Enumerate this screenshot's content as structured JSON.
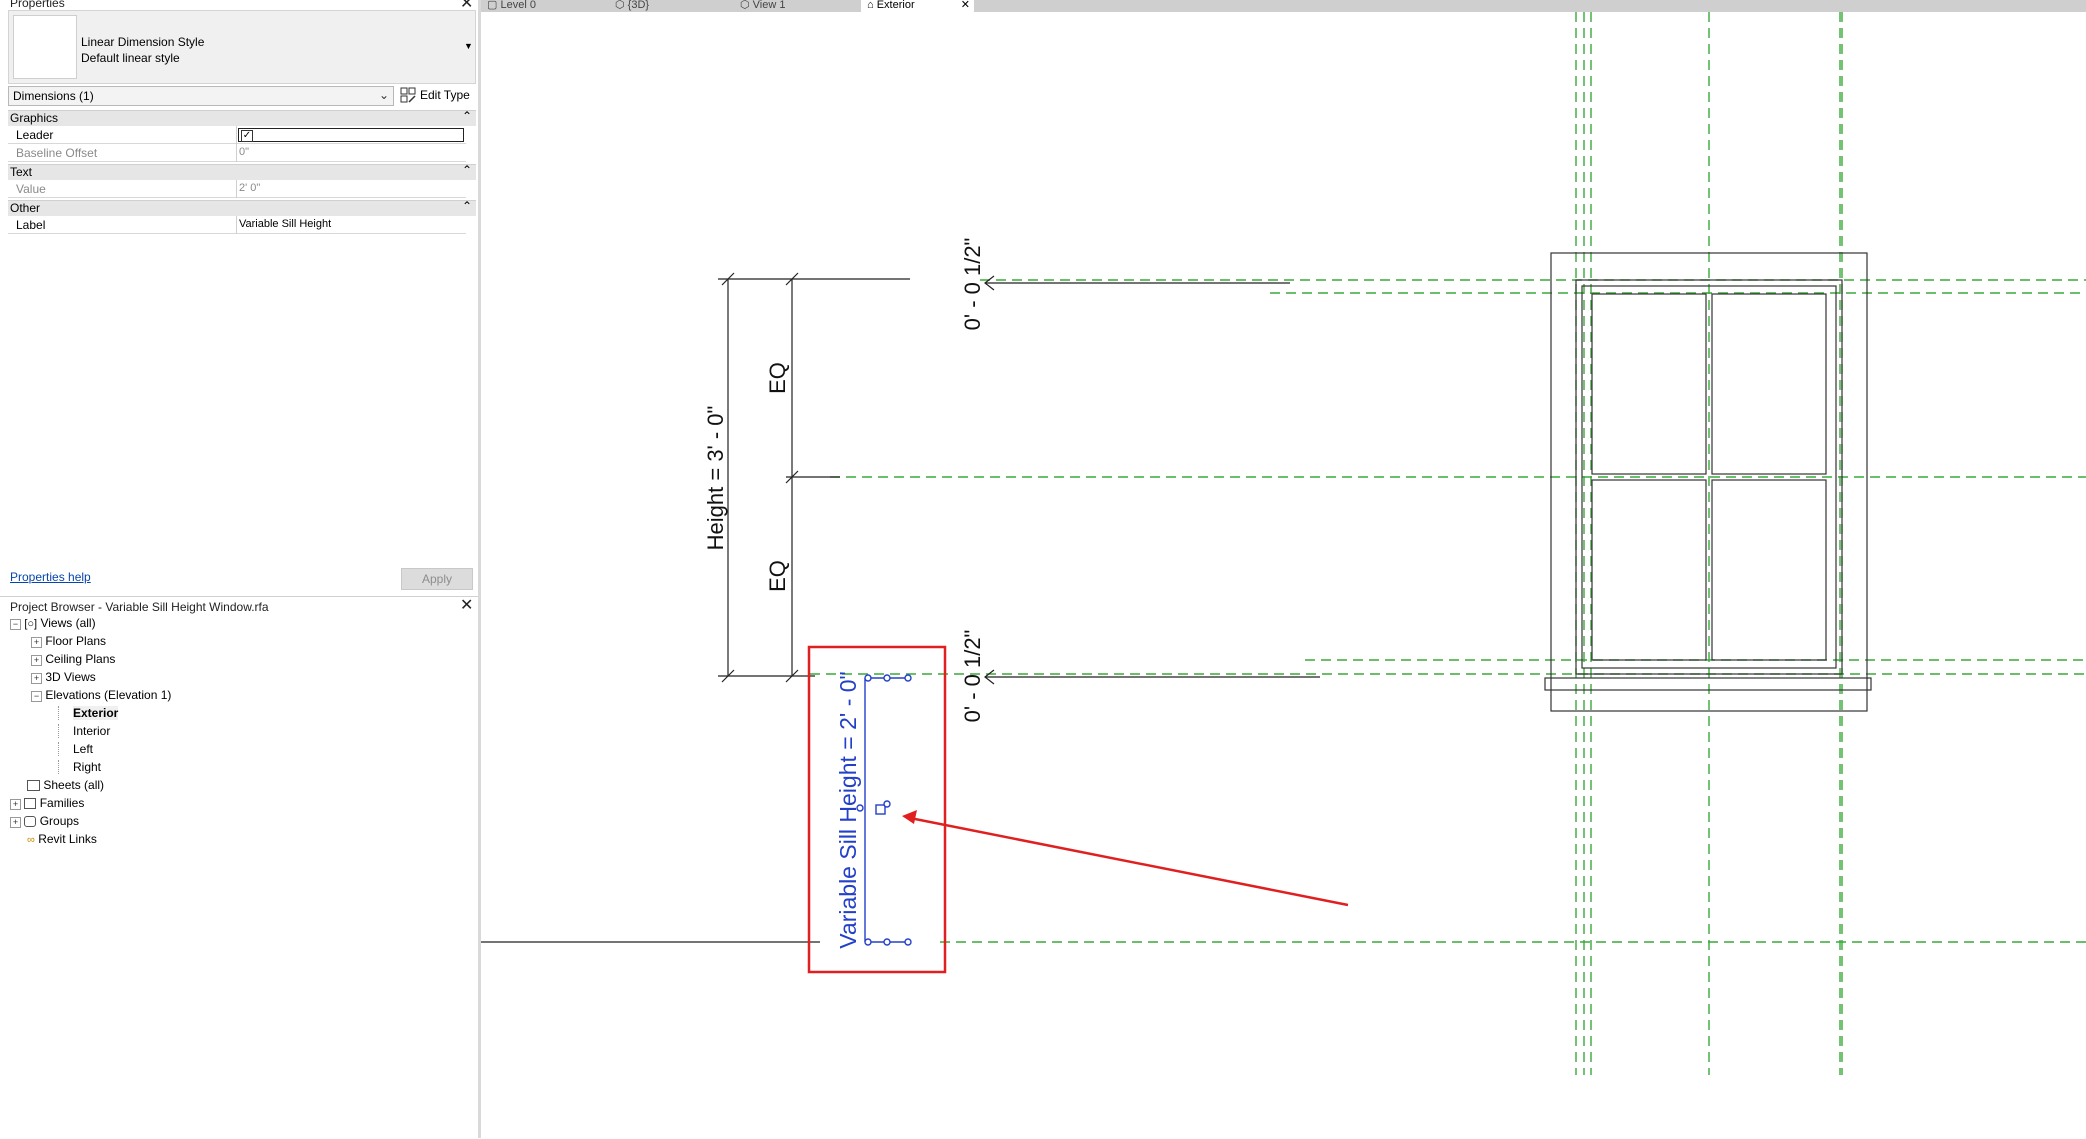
{
  "properties": {
    "title": "Properties",
    "type_line1": "Linear Dimension Style",
    "type_line2": "Default linear style",
    "selector": "Dimensions (1)",
    "edit_type": "Edit Type",
    "categories": {
      "graphics": "Graphics",
      "text": "Text",
      "other": "Other"
    },
    "rows": {
      "leader": {
        "key": "Leader",
        "checked": true
      },
      "baseline_offset": {
        "key": "Baseline Offset",
        "value": "0\""
      },
      "value": {
        "key": "Value",
        "value": "2'  0\""
      },
      "label": {
        "key": "Label",
        "value": "Variable Sill Height"
      }
    },
    "help": "Properties help",
    "apply": "Apply"
  },
  "browser": {
    "title": "Project Browser - Variable Sill Height Window.rfa",
    "items": {
      "views": "Views (all)",
      "floor_plans": "Floor Plans",
      "ceiling_plans": "Ceiling Plans",
      "views_3d": "3D Views",
      "elevations": "Elevations (Elevation 1)",
      "exterior": "Exterior",
      "interior": "Interior",
      "left": "Left",
      "right": "Right",
      "sheets": "Sheets (all)",
      "families": "Families",
      "groups": "Groups",
      "revit_links": "Revit Links"
    }
  },
  "tabs": [
    "Level 0",
    "{3D}",
    "View 1",
    "Exterior"
  ],
  "drawing": {
    "height_dim": "Height = 3' - 0\"",
    "eq_top": "EQ",
    "eq_bottom": "EQ",
    "offset_top": "0' - 0 1/2\"",
    "offset_bottom": "0' - 0 1/2\"",
    "sill_dim": "Variable Sill Height = 2' - 0\""
  },
  "colors": {
    "reference_green": "#3aa83a",
    "selected_blue": "#2340c8",
    "highlight_red": "#e02020"
  }
}
